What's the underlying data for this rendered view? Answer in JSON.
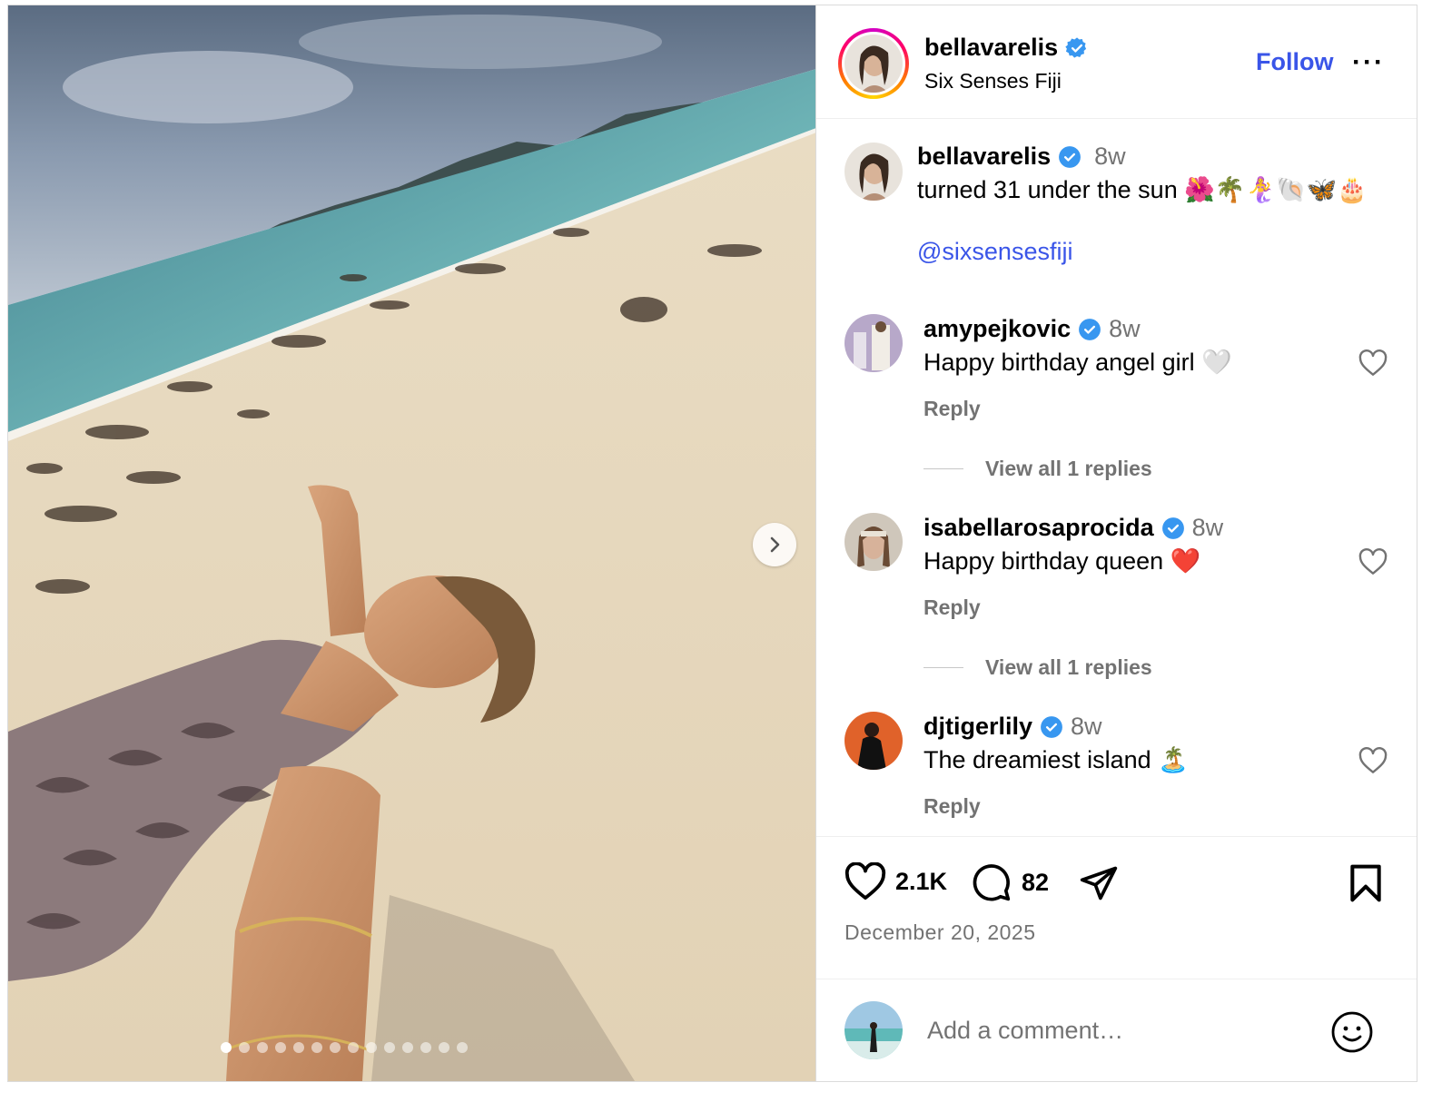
{
  "post": {
    "carousel": {
      "slides": 14,
      "active_index": 0
    }
  },
  "header": {
    "username": "bellavarelis",
    "location": "Six Senses Fiji",
    "follow_label": "Follow",
    "more_label": "···"
  },
  "caption": {
    "username": "bellavarelis",
    "time": "8w",
    "text": "turned 31 under the sun 🌺🌴🧜‍♀️🐚🦋🎂",
    "mention": "@sixsensesfiji"
  },
  "comments": [
    {
      "username": "amypejkovic",
      "time": "8w",
      "text": "Happy birthday angel girl 🤍",
      "reply_label": "Reply",
      "view_replies": "View all 1 replies"
    },
    {
      "username": "isabellarosaprocida",
      "time": "8w",
      "text": "Happy birthday queen ❤️",
      "reply_label": "Reply",
      "view_replies": "View all 1 replies"
    },
    {
      "username": "djtigerlily",
      "time": "8w",
      "text": "The dreamiest island 🏝️",
      "reply_label": "Reply"
    }
  ],
  "stats": {
    "likes": "2.1K",
    "comments": "82"
  },
  "date": "December 20, 2025",
  "composer": {
    "placeholder": "Add a comment…"
  },
  "colors": {
    "link_blue": "#3a55e8",
    "verified_blue": "#0095f6",
    "muted_text": "#737373"
  }
}
